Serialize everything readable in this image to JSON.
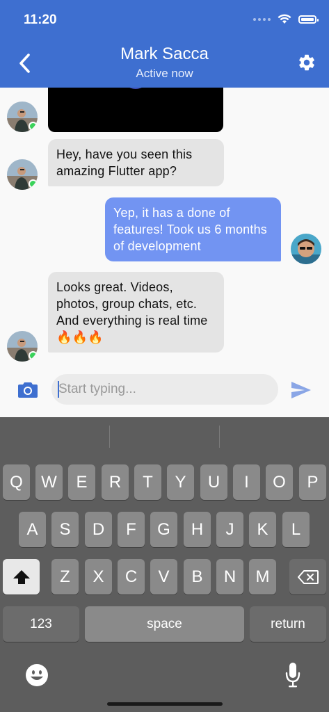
{
  "status_bar": {
    "time": "11:20"
  },
  "header": {
    "title": "Mark Sacca",
    "subtitle": "Active now",
    "back_icon": "chevron-left-icon",
    "settings_icon": "gear-icon"
  },
  "messages": [
    {
      "from": "contact",
      "type": "video"
    },
    {
      "from": "contact",
      "text": "Hey, have you seen this amazing Flutter app?"
    },
    {
      "from": "me",
      "text": "Yep, it has a done of features! Took us 6 months of development"
    },
    {
      "from": "contact",
      "text": "Looks great. Videos, photos, group chats, etc. And everything is real time 🔥🔥🔥"
    }
  ],
  "composer": {
    "placeholder": "Start typing...",
    "camera_icon": "camera-icon",
    "send_icon": "send-icon"
  },
  "keyboard": {
    "row1": [
      "Q",
      "W",
      "E",
      "R",
      "T",
      "Y",
      "U",
      "I",
      "O",
      "P"
    ],
    "row2": [
      "A",
      "S",
      "D",
      "F",
      "G",
      "H",
      "J",
      "K",
      "L"
    ],
    "row3": [
      "Z",
      "X",
      "C",
      "V",
      "B",
      "N",
      "M"
    ],
    "numbers_label": "123",
    "space_label": "space",
    "return_label": "return"
  },
  "colors": {
    "accent": "#3e6fd0",
    "outgoing_bubble": "#7294f2",
    "incoming_bubble": "#e4e4e4",
    "online": "#3ad35a"
  }
}
